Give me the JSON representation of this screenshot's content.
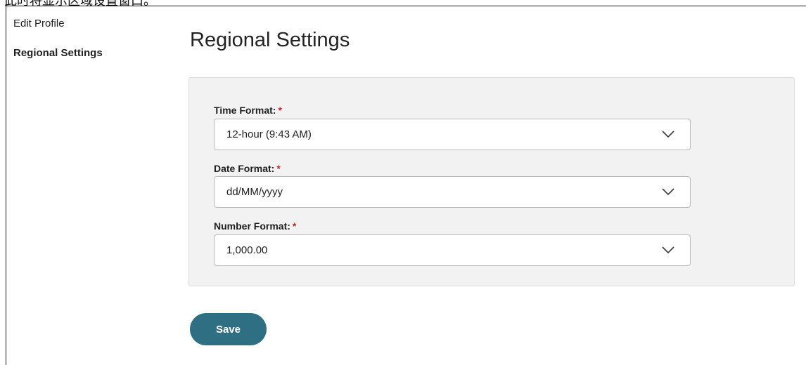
{
  "caption": "此时将显示区域设置窗口。",
  "sidebar": {
    "items": [
      {
        "label": "Edit Profile",
        "active": false
      },
      {
        "label": "Regional Settings",
        "active": true
      }
    ]
  },
  "main": {
    "title": "Regional Settings",
    "fields": {
      "time": {
        "label": "Time Format:",
        "required_mark": "*",
        "value": "12-hour (9:43 AM)"
      },
      "date": {
        "label": "Date Format:",
        "required_mark": "*",
        "value": "dd/MM/yyyy"
      },
      "number": {
        "label": "Number Format:",
        "required_mark": "*",
        "value": "1,000.00"
      }
    },
    "save_label": "Save"
  },
  "colors": {
    "primary_button": "#2f6f84",
    "required": "#c62828",
    "panel_bg": "#f2f2f2"
  },
  "icons": {
    "dropdown": "chevron-down-icon"
  }
}
